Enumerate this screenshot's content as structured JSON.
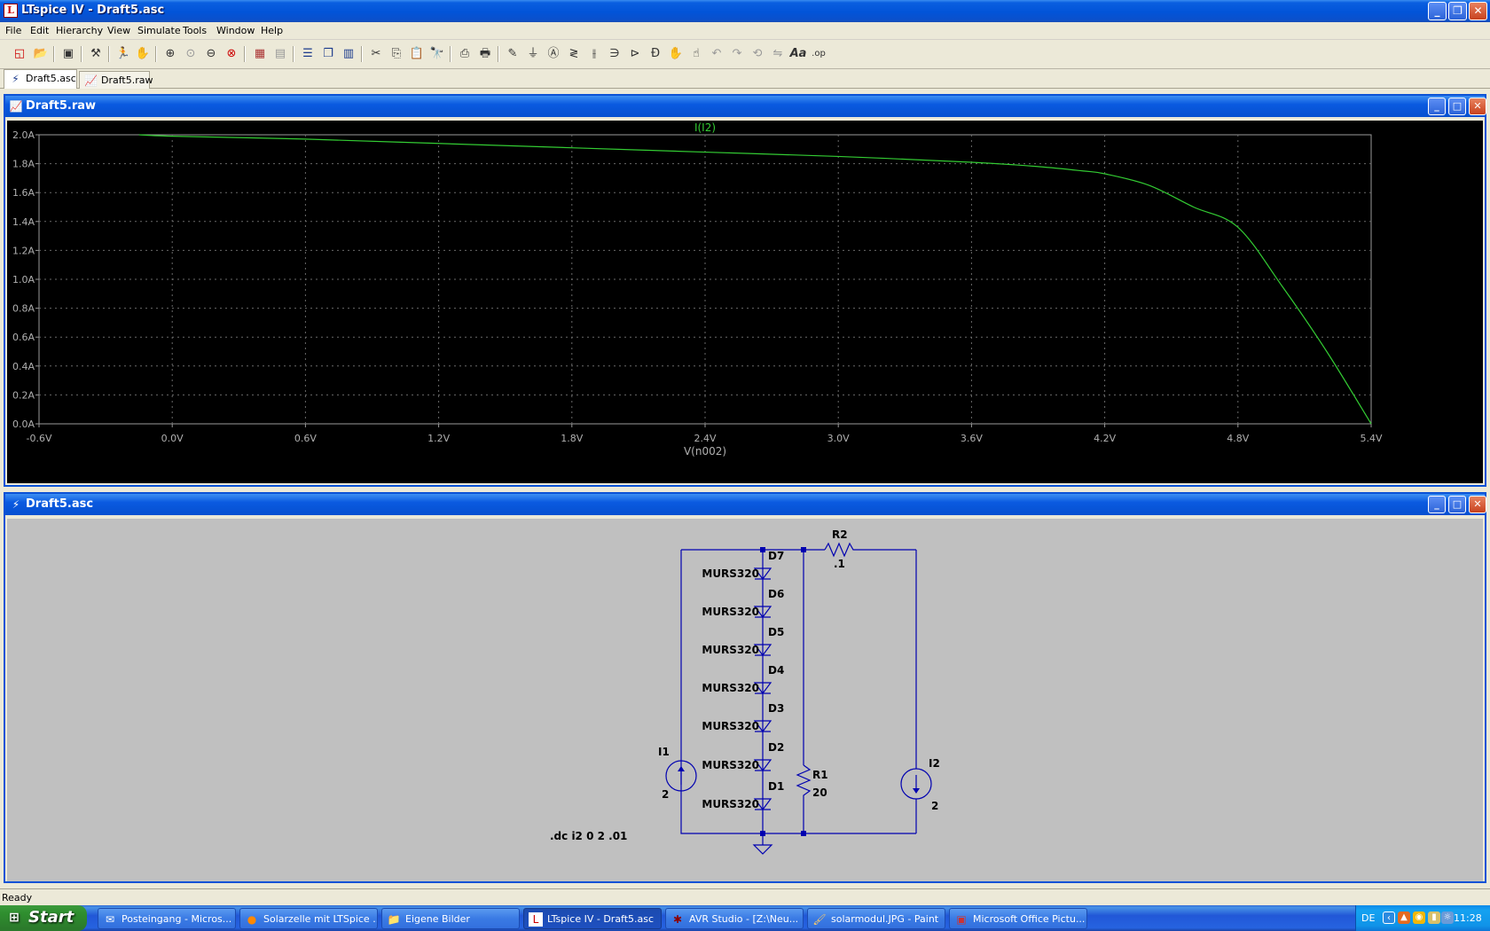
{
  "window": {
    "title": "LTspice IV - Draft5.asc",
    "app_icon": "ltspice-icon"
  },
  "menu": [
    "File",
    "Edit",
    "Hierarchy",
    "View",
    "Simulate",
    "Tools",
    "Window",
    "Help"
  ],
  "doc_tabs": [
    {
      "label": "Draft5.asc",
      "icon": "schematic-icon",
      "active": true
    },
    {
      "label": "Draft5.raw",
      "icon": "waveform-icon",
      "active": false
    }
  ],
  "plot_window": {
    "title": "Draft5.raw",
    "icon": "waveform-icon"
  },
  "schematic_window": {
    "title": "Draft5.asc",
    "icon": "schematic-icon"
  },
  "chart_data": {
    "type": "line",
    "background": "#000000",
    "trace_color": "#33cc33",
    "grid": true,
    "title": "I(I2)",
    "xlabel": "V(n002)",
    "ylabel": "",
    "xlim": [
      -0.6,
      5.4
    ],
    "ylim": [
      0.0,
      2.0
    ],
    "x_ticks": [
      "-0.6V",
      "0.0V",
      "0.6V",
      "1.2V",
      "1.8V",
      "2.4V",
      "3.0V",
      "3.6V",
      "4.2V",
      "4.8V",
      "5.4V"
    ],
    "y_ticks": [
      "0.0A",
      "0.2A",
      "0.4A",
      "0.6A",
      "0.8A",
      "1.0A",
      "1.2A",
      "1.4A",
      "1.6A",
      "1.8A",
      "2.0A"
    ],
    "series": [
      {
        "name": "I(I2)",
        "x": [
          -0.15,
          0.0,
          0.6,
          1.2,
          1.8,
          2.4,
          3.0,
          3.6,
          3.9,
          4.1,
          4.2,
          4.4,
          4.6,
          4.8,
          5.0,
          5.2,
          5.4
        ],
        "y": [
          2.0,
          1.99,
          1.97,
          1.94,
          1.91,
          1.88,
          1.85,
          1.81,
          1.78,
          1.75,
          1.73,
          1.65,
          1.5,
          1.36,
          0.95,
          0.5,
          0.0
        ]
      }
    ]
  },
  "schematic": {
    "directive": ".dc i2 0 2 .01",
    "components": [
      {
        "ref": "D7",
        "value": "MURS320"
      },
      {
        "ref": "D6",
        "value": "MURS320"
      },
      {
        "ref": "D5",
        "value": "MURS320"
      },
      {
        "ref": "D4",
        "value": "MURS320"
      },
      {
        "ref": "D3",
        "value": "MURS320"
      },
      {
        "ref": "D2",
        "value": "MURS320"
      },
      {
        "ref": "D1",
        "value": "MURS320"
      }
    ],
    "r2": {
      "ref": "R2",
      "value": ".1"
    },
    "r1": {
      "ref": "R1",
      "value": "20"
    },
    "i1": {
      "ref": "I1",
      "value": "2"
    },
    "i2": {
      "ref": "I2",
      "value": "2"
    },
    "wire_color": "#0000b0"
  },
  "status": "Ready",
  "taskbar": {
    "start_label": "Start",
    "tasks": [
      {
        "label": "Posteingang - Micros...",
        "icon": "outlook-icon",
        "active": false
      },
      {
        "label": "Solarzelle mit LTSpice ...",
        "icon": "firefox-icon",
        "active": false
      },
      {
        "label": "Eigene Bilder",
        "icon": "folder-icon",
        "active": false
      },
      {
        "label": "LTspice IV - Draft5.asc",
        "icon": "ltspice-icon",
        "active": true
      },
      {
        "label": "AVR Studio - [Z:\\Neu...",
        "icon": "avr-icon",
        "active": false
      },
      {
        "label": "solarmodul.JPG - Paint",
        "icon": "paint-icon",
        "active": false
      },
      {
        "label": "Microsoft Office Pictu...",
        "icon": "picture-manager-icon",
        "active": false
      }
    ],
    "language": "DE",
    "clock": "11:28"
  }
}
